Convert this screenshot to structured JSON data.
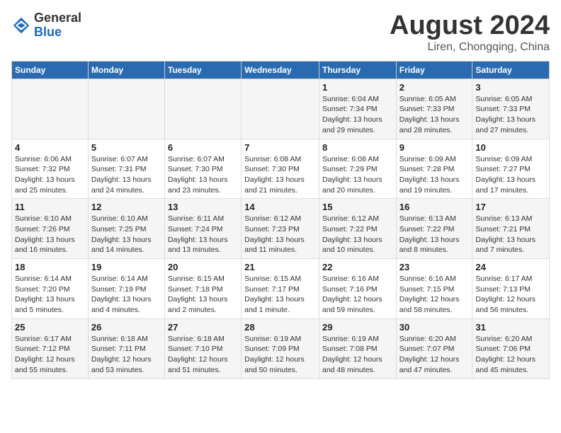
{
  "header": {
    "logo_line1": "General",
    "logo_line2": "Blue",
    "main_title": "August 2024",
    "subtitle": "Liren, Chongqing, China"
  },
  "weekdays": [
    "Sunday",
    "Monday",
    "Tuesday",
    "Wednesday",
    "Thursday",
    "Friday",
    "Saturday"
  ],
  "weeks": [
    [
      {
        "day": "",
        "info": ""
      },
      {
        "day": "",
        "info": ""
      },
      {
        "day": "",
        "info": ""
      },
      {
        "day": "",
        "info": ""
      },
      {
        "day": "1",
        "info": "Sunrise: 6:04 AM\nSunset: 7:34 PM\nDaylight: 13 hours and 29 minutes."
      },
      {
        "day": "2",
        "info": "Sunrise: 6:05 AM\nSunset: 7:33 PM\nDaylight: 13 hours and 28 minutes."
      },
      {
        "day": "3",
        "info": "Sunrise: 6:05 AM\nSunset: 7:33 PM\nDaylight: 13 hours and 27 minutes."
      }
    ],
    [
      {
        "day": "4",
        "info": "Sunrise: 6:06 AM\nSunset: 7:32 PM\nDaylight: 13 hours and 25 minutes."
      },
      {
        "day": "5",
        "info": "Sunrise: 6:07 AM\nSunset: 7:31 PM\nDaylight: 13 hours and 24 minutes."
      },
      {
        "day": "6",
        "info": "Sunrise: 6:07 AM\nSunset: 7:30 PM\nDaylight: 13 hours and 23 minutes."
      },
      {
        "day": "7",
        "info": "Sunrise: 6:08 AM\nSunset: 7:30 PM\nDaylight: 13 hours and 21 minutes."
      },
      {
        "day": "8",
        "info": "Sunrise: 6:08 AM\nSunset: 7:29 PM\nDaylight: 13 hours and 20 minutes."
      },
      {
        "day": "9",
        "info": "Sunrise: 6:09 AM\nSunset: 7:28 PM\nDaylight: 13 hours and 19 minutes."
      },
      {
        "day": "10",
        "info": "Sunrise: 6:09 AM\nSunset: 7:27 PM\nDaylight: 13 hours and 17 minutes."
      }
    ],
    [
      {
        "day": "11",
        "info": "Sunrise: 6:10 AM\nSunset: 7:26 PM\nDaylight: 13 hours and 16 minutes."
      },
      {
        "day": "12",
        "info": "Sunrise: 6:10 AM\nSunset: 7:25 PM\nDaylight: 13 hours and 14 minutes."
      },
      {
        "day": "13",
        "info": "Sunrise: 6:11 AM\nSunset: 7:24 PM\nDaylight: 13 hours and 13 minutes."
      },
      {
        "day": "14",
        "info": "Sunrise: 6:12 AM\nSunset: 7:23 PM\nDaylight: 13 hours and 11 minutes."
      },
      {
        "day": "15",
        "info": "Sunrise: 6:12 AM\nSunset: 7:22 PM\nDaylight: 13 hours and 10 minutes."
      },
      {
        "day": "16",
        "info": "Sunrise: 6:13 AM\nSunset: 7:22 PM\nDaylight: 13 hours and 8 minutes."
      },
      {
        "day": "17",
        "info": "Sunrise: 6:13 AM\nSunset: 7:21 PM\nDaylight: 13 hours and 7 minutes."
      }
    ],
    [
      {
        "day": "18",
        "info": "Sunrise: 6:14 AM\nSunset: 7:20 PM\nDaylight: 13 hours and 5 minutes."
      },
      {
        "day": "19",
        "info": "Sunrise: 6:14 AM\nSunset: 7:19 PM\nDaylight: 13 hours and 4 minutes."
      },
      {
        "day": "20",
        "info": "Sunrise: 6:15 AM\nSunset: 7:18 PM\nDaylight: 13 hours and 2 minutes."
      },
      {
        "day": "21",
        "info": "Sunrise: 6:15 AM\nSunset: 7:17 PM\nDaylight: 13 hours and 1 minute."
      },
      {
        "day": "22",
        "info": "Sunrise: 6:16 AM\nSunset: 7:16 PM\nDaylight: 12 hours and 59 minutes."
      },
      {
        "day": "23",
        "info": "Sunrise: 6:16 AM\nSunset: 7:15 PM\nDaylight: 12 hours and 58 minutes."
      },
      {
        "day": "24",
        "info": "Sunrise: 6:17 AM\nSunset: 7:13 PM\nDaylight: 12 hours and 56 minutes."
      }
    ],
    [
      {
        "day": "25",
        "info": "Sunrise: 6:17 AM\nSunset: 7:12 PM\nDaylight: 12 hours and 55 minutes."
      },
      {
        "day": "26",
        "info": "Sunrise: 6:18 AM\nSunset: 7:11 PM\nDaylight: 12 hours and 53 minutes."
      },
      {
        "day": "27",
        "info": "Sunrise: 6:18 AM\nSunset: 7:10 PM\nDaylight: 12 hours and 51 minutes."
      },
      {
        "day": "28",
        "info": "Sunrise: 6:19 AM\nSunset: 7:09 PM\nDaylight: 12 hours and 50 minutes."
      },
      {
        "day": "29",
        "info": "Sunrise: 6:19 AM\nSunset: 7:08 PM\nDaylight: 12 hours and 48 minutes."
      },
      {
        "day": "30",
        "info": "Sunrise: 6:20 AM\nSunset: 7:07 PM\nDaylight: 12 hours and 47 minutes."
      },
      {
        "day": "31",
        "info": "Sunrise: 6:20 AM\nSunset: 7:06 PM\nDaylight: 12 hours and 45 minutes."
      }
    ]
  ]
}
